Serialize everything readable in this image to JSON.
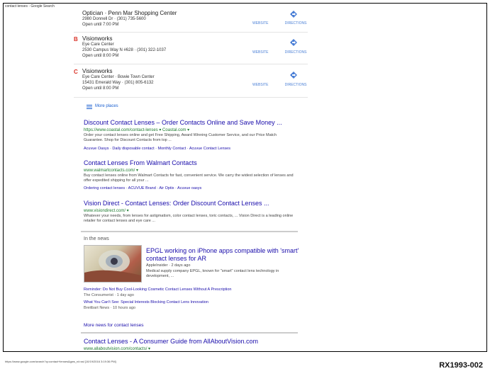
{
  "header": {
    "title": "contact lenses - Google Search"
  },
  "locations": [
    {
      "letter": "",
      "name": "Optician · Penn Mar Shopping Center",
      "line1": "2980 Donnell Dr · (301) 735-5600",
      "line2": "Open until 7:00 PM",
      "website": "WEBSITE",
      "directions": "DIRECTIONS"
    },
    {
      "letter": "B",
      "name": "Visionworks",
      "line1": "Eye Care Center",
      "line2": "2530 Campus Way N #628 · (301) 322-1037",
      "line3": "Open until 8:00 PM",
      "website": "WEBSITE",
      "directions": "DIRECTIONS"
    },
    {
      "letter": "C",
      "name": "Visionworks",
      "line1": "Eye Care Center · Bowie Town Center",
      "line2": "15431 Emerald Way · (301) 805-6132",
      "line3": "Open until 8:00 PM",
      "website": "WEBSITE",
      "directions": "DIRECTIONS"
    }
  ],
  "more_places": "More places",
  "results": [
    {
      "title": "Discount Contact Lenses – Order Contacts Online and Save Money ...",
      "url": "https://www.coastal.com/contact-lenses ▾  Coastal.com ▾",
      "snippet": "Order your contact lenses online and get Free Shipping, Award Winning Customer Service, and our Price Match Guarantee. Shop for Discount Contacts from top ...",
      "links": "Acuvue Oasys · Daily disposable contact · Monthly Contact · Acuvue Contact Lenses"
    },
    {
      "title": "Contact Lenses From Walmart Contacts",
      "url": "www.walmartcontacts.com/ ▾",
      "snippet": "Buy contact lenses online from Walmart Contacts for fast, convenient service. We carry the widest selection of lenses and offer expedited shipping for all your ...",
      "links": "Ordering contact lenses · ACUVUE Brand · Air Optix · Acuvue oasys"
    },
    {
      "title": "Vision Direct - Contact Lenses: Order Discount Contact Lenses ...",
      "url": "www.visiondirect.com/ ▾",
      "snippet": "Whatever your needs, from lenses for astigmatism, color contact lenses, toric contacts, ... Vision Direct is a leading online retailer for contact lenses and eye care ..."
    }
  ],
  "news": {
    "header": "In the news",
    "title_line1": "EPGL working on iPhone apps compatible with 'smart'",
    "title_line2": "contact lenses for AR",
    "source": "AppleInsider · 2 days ago",
    "snippet": "Medical supply company EPGL, known for \"smart\" contact lens technology in development, ...",
    "items": [
      {
        "title": "Reminder: Do Not Buy Cool-Looking Cosmetic Contact Lenses Without A Prescription",
        "source": "The Consumerist · 1 day ago"
      },
      {
        "title": "What You Can't See: Special Interests Blocking Contact Lens Innovation",
        "source": "Breitbart News · 10 hours ago"
      }
    ],
    "more": "More news for contact lenses"
  },
  "last_result": {
    "title": "Contact Lenses - A Consumer Guide from AllAboutVision.com",
    "url": "www.allaboutvision.com/contacts/ ▾"
  },
  "footer": {
    "url": "https://www.google.com/search?q=contact+lenses&gws_rd=ssl [10/19/2016 3:19:36 PM]",
    "exhibit": "RX1993-002"
  }
}
